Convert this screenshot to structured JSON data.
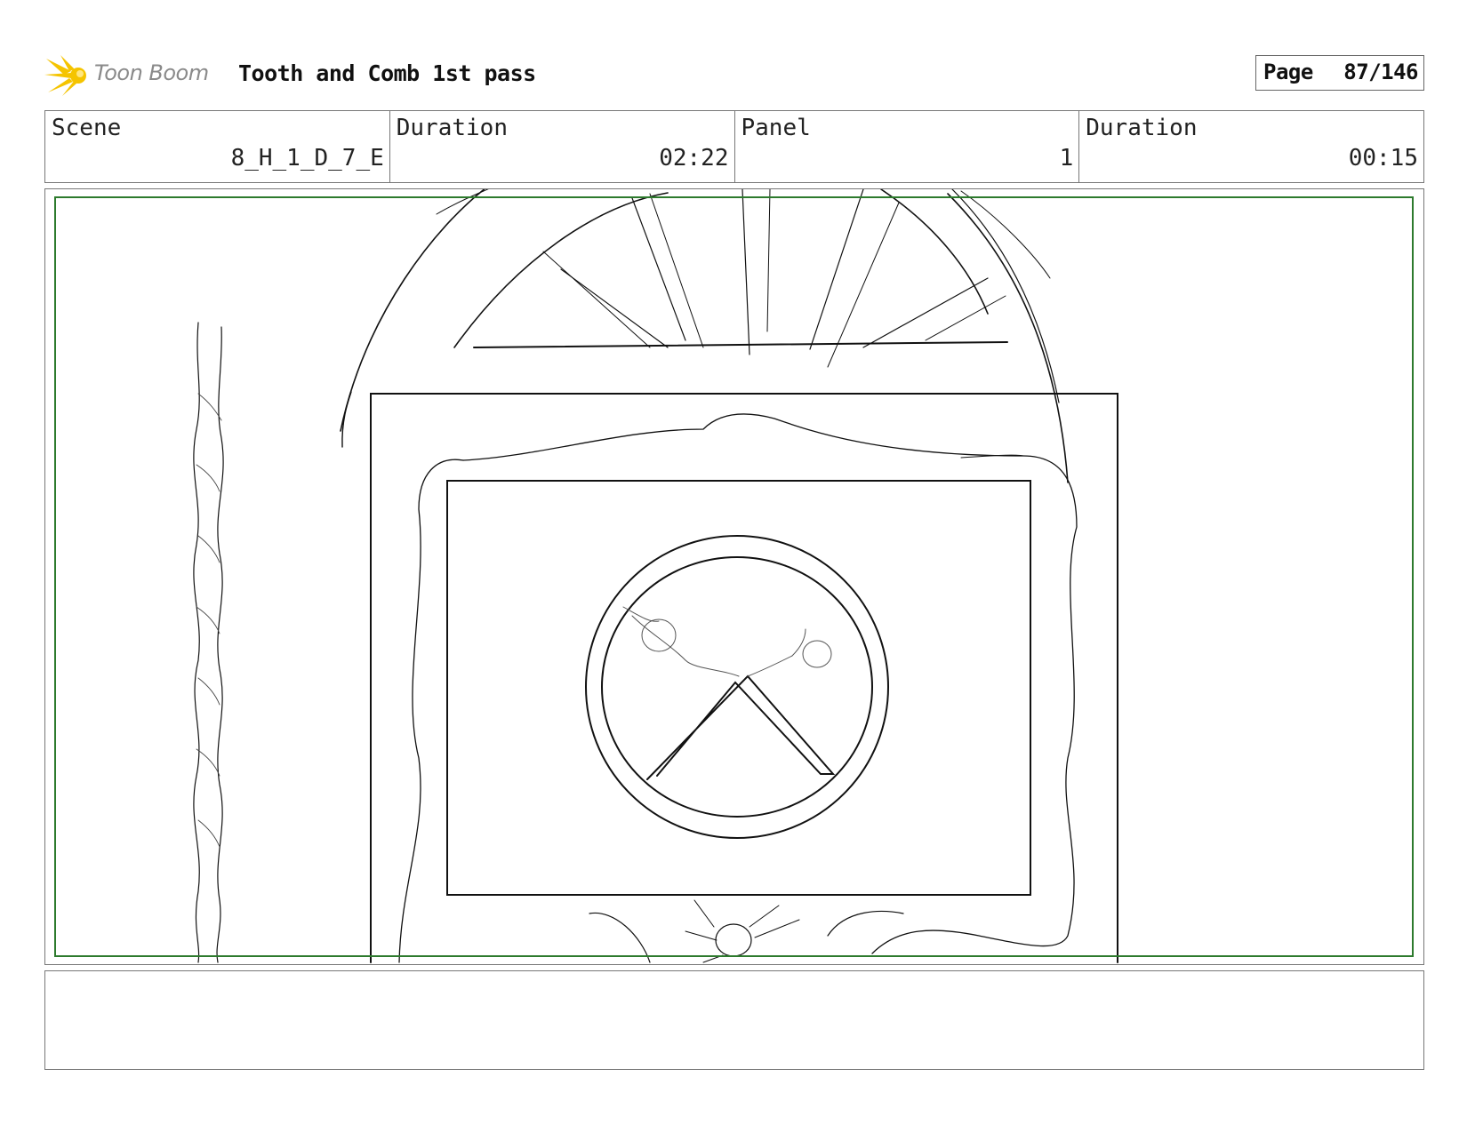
{
  "header": {
    "logo_text": "Toon Boom",
    "title": "Tooth and Comb 1st pass",
    "page_label": "Page",
    "page_value": "87/146"
  },
  "info": {
    "scene_label": "Scene",
    "scene_value": "8_H_1_D_7_E",
    "duration_label": "Duration",
    "duration_value": "02:22",
    "panel_label": "Panel",
    "panel_value": "1",
    "panel_duration_label": "Duration",
    "panel_duration_value": "00:15"
  },
  "colors": {
    "safe_frame": "#2d7a2d",
    "logo": "#f5c400"
  },
  "icons": [
    "toon-boom-logo-icon",
    "scissors-sign-icon"
  ],
  "notes": ""
}
